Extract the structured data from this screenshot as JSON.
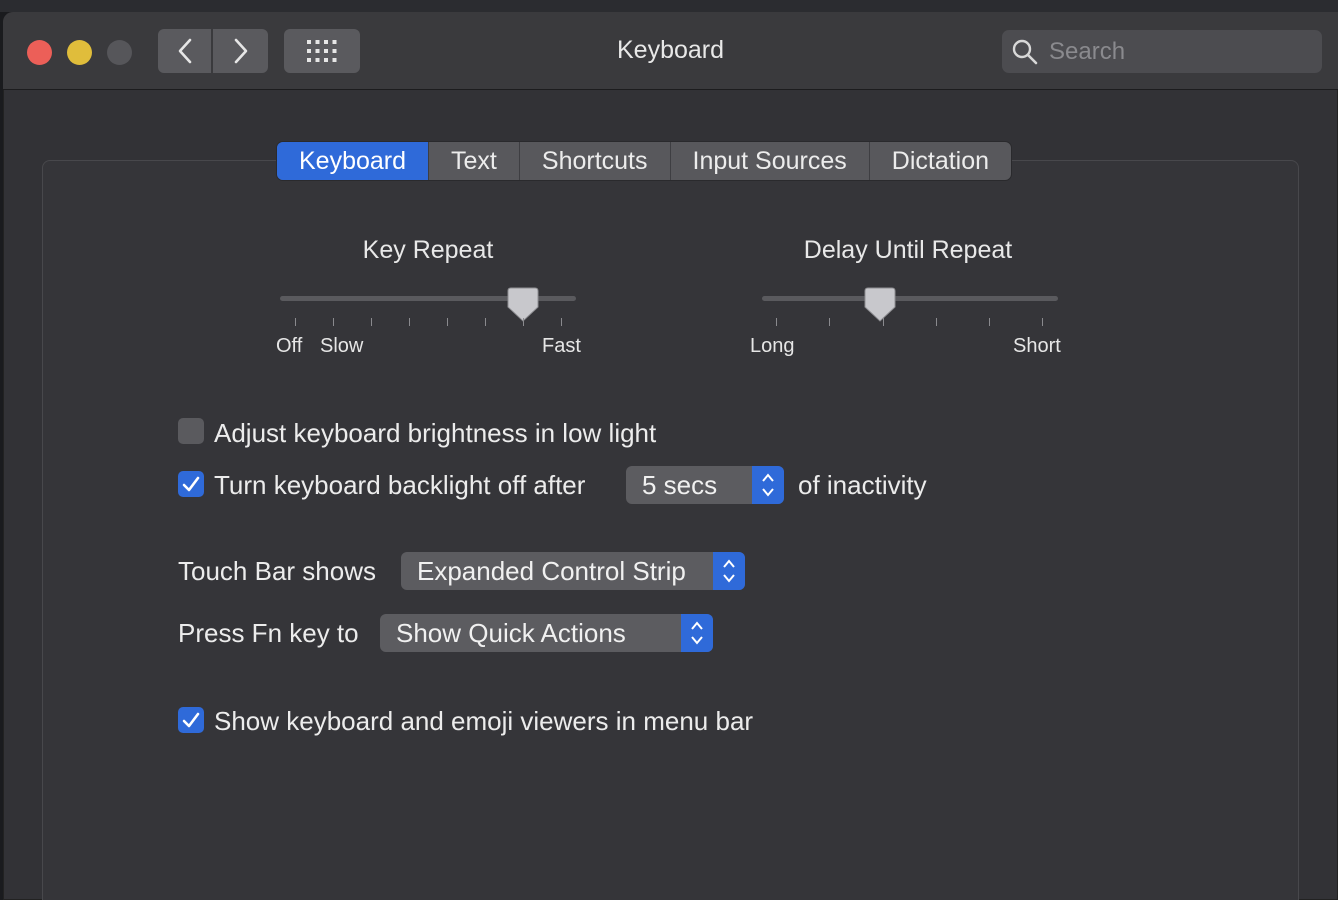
{
  "window": {
    "title": "Keyboard",
    "search_placeholder": "Search"
  },
  "tabs": [
    {
      "label": "Keyboard",
      "active": true
    },
    {
      "label": "Text",
      "active": false
    },
    {
      "label": "Shortcuts",
      "active": false
    },
    {
      "label": "Input Sources",
      "active": false
    },
    {
      "label": "Dictation",
      "active": false
    }
  ],
  "key_repeat": {
    "title": "Key Repeat",
    "label_off": "Off",
    "label_slow": "Slow",
    "label_fast": "Fast",
    "level": 0.82
  },
  "delay_until_repeat": {
    "title": "Delay Until Repeat",
    "label_long": "Long",
    "label_short": "Short",
    "level": 0.4
  },
  "options": {
    "brightness_label": "Adjust keyboard brightness in low light",
    "brightness_checked": false,
    "backlight_label": "Turn keyboard backlight off after",
    "backlight_checked": true,
    "backlight_value": "5 secs",
    "backlight_suffix": "of inactivity",
    "touchbar_label": "Touch Bar shows",
    "touchbar_value": "Expanded Control Strip",
    "fn_label": "Press Fn key to",
    "fn_value": "Show Quick Actions",
    "viewers_label": "Show keyboard and emoji viewers in menu bar",
    "viewers_checked": true
  },
  "colors": {
    "accent": "#2f6ad9",
    "close": "#ec5f58",
    "minimize": "#e0bd3b",
    "zoom_disabled": "#56565a"
  }
}
